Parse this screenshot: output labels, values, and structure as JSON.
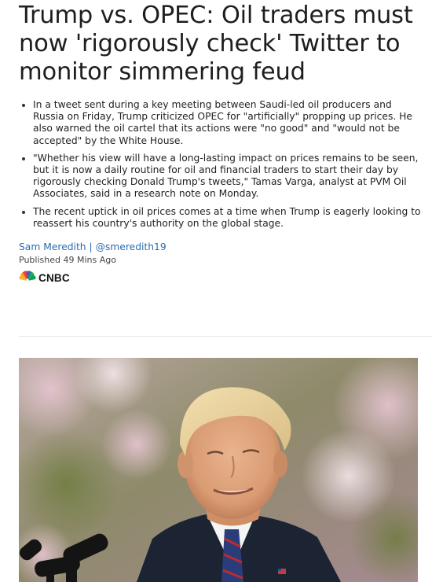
{
  "article": {
    "headline": "Trump vs. OPEC: Oil traders must now 'rigorously check' Twitter to monitor simmering feud",
    "bullets": [
      "In a tweet sent during a key meeting between Saudi-led oil producers and Russia on Friday, Trump criticized OPEC for \"artificially\" propping up prices. He also warned the oil cartel that its actions were \"no good\" and \"would not be accepted\" by the White House.",
      "\"Whether his view will have a long-lasting impact on prices remains to be seen, but it is now a daily routine for oil and financial traders to start their day by rigorously checking Donald Trump's tweets,\" Tamas Varga, analyst at PVM Oil Associates, said in a research note on Monday.",
      "The recent uptick in oil prices comes at a time when Trump is eagerly looking to reassert his country's authority on the global stage."
    ],
    "author": "Sam Meredith",
    "separator": "|",
    "handle": "@smeredith19",
    "published": "Published 49 Mins Ago",
    "source_logo_text": "CNBC"
  },
  "colors": {
    "link": "#2b6cb0",
    "text": "#222222",
    "headline": "#1e1e1e"
  },
  "icons": {
    "source_logo": "nbc-peacock-icon",
    "photo": "speaker-at-podium-photo"
  }
}
